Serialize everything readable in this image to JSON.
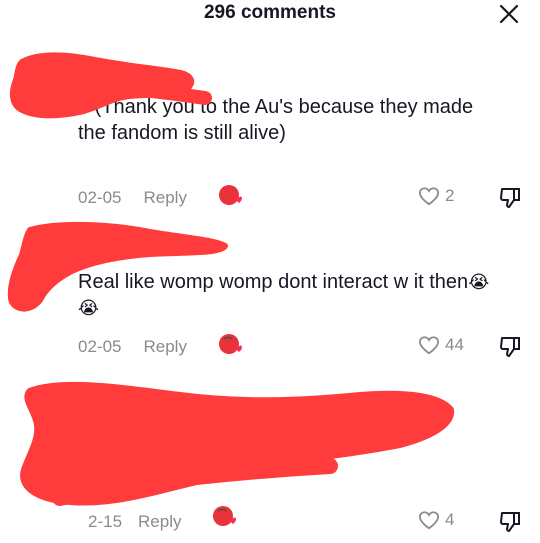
{
  "header": {
    "title": "296 comments"
  },
  "comments": [
    {
      "text": "e (Thank you to the Au's because they made the fandom is still alive)",
      "date": "02-05",
      "reply": "Reply",
      "likes": "2"
    },
    {
      "text": "Real like womp womp dont interact w it then",
      "emoji": "😭😭",
      "date": "02-05",
      "reply": "Reply",
      "likes": "44"
    },
    {
      "date": "2-15",
      "reply": "Reply",
      "likes": "4"
    }
  ],
  "colors": {
    "redaction": "#ff3b3b",
    "muted": "#8a8b91",
    "text": "#161823"
  }
}
